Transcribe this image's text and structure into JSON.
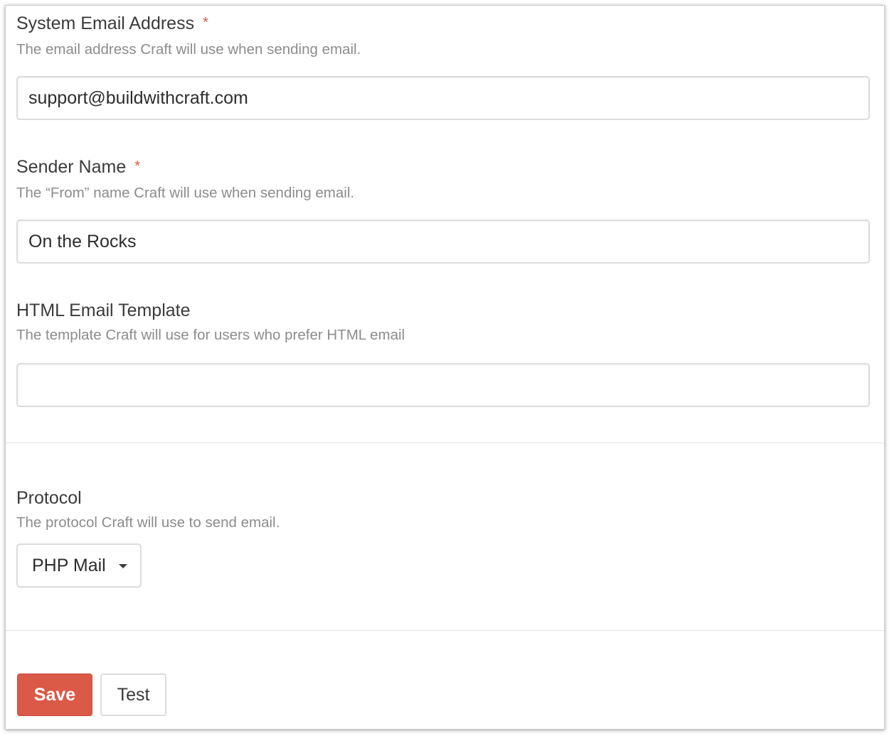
{
  "fields": {
    "system_email": {
      "label": "System Email Address",
      "required_marker": "*",
      "instructions": "The email address Craft will use when sending email.",
      "value": "support@buildwithcraft.com"
    },
    "sender_name": {
      "label": "Sender Name",
      "required_marker": "*",
      "instructions": "The “From” name Craft will use when sending email.",
      "value": "On the Rocks"
    },
    "html_template": {
      "label": "HTML Email Template",
      "instructions": "The template Craft will use for users who prefer HTML email",
      "value": ""
    },
    "protocol": {
      "label": "Protocol",
      "instructions": "The protocol Craft will use to send email.",
      "selected": "PHP Mail",
      "icon": "chevron-down-icon"
    }
  },
  "actions": {
    "save_label": "Save",
    "test_label": "Test"
  },
  "colors": {
    "accent": "#da5a47",
    "label": "#3b3b3b",
    "instructions": "#8c8c8c",
    "border": "#dcdcdc"
  }
}
